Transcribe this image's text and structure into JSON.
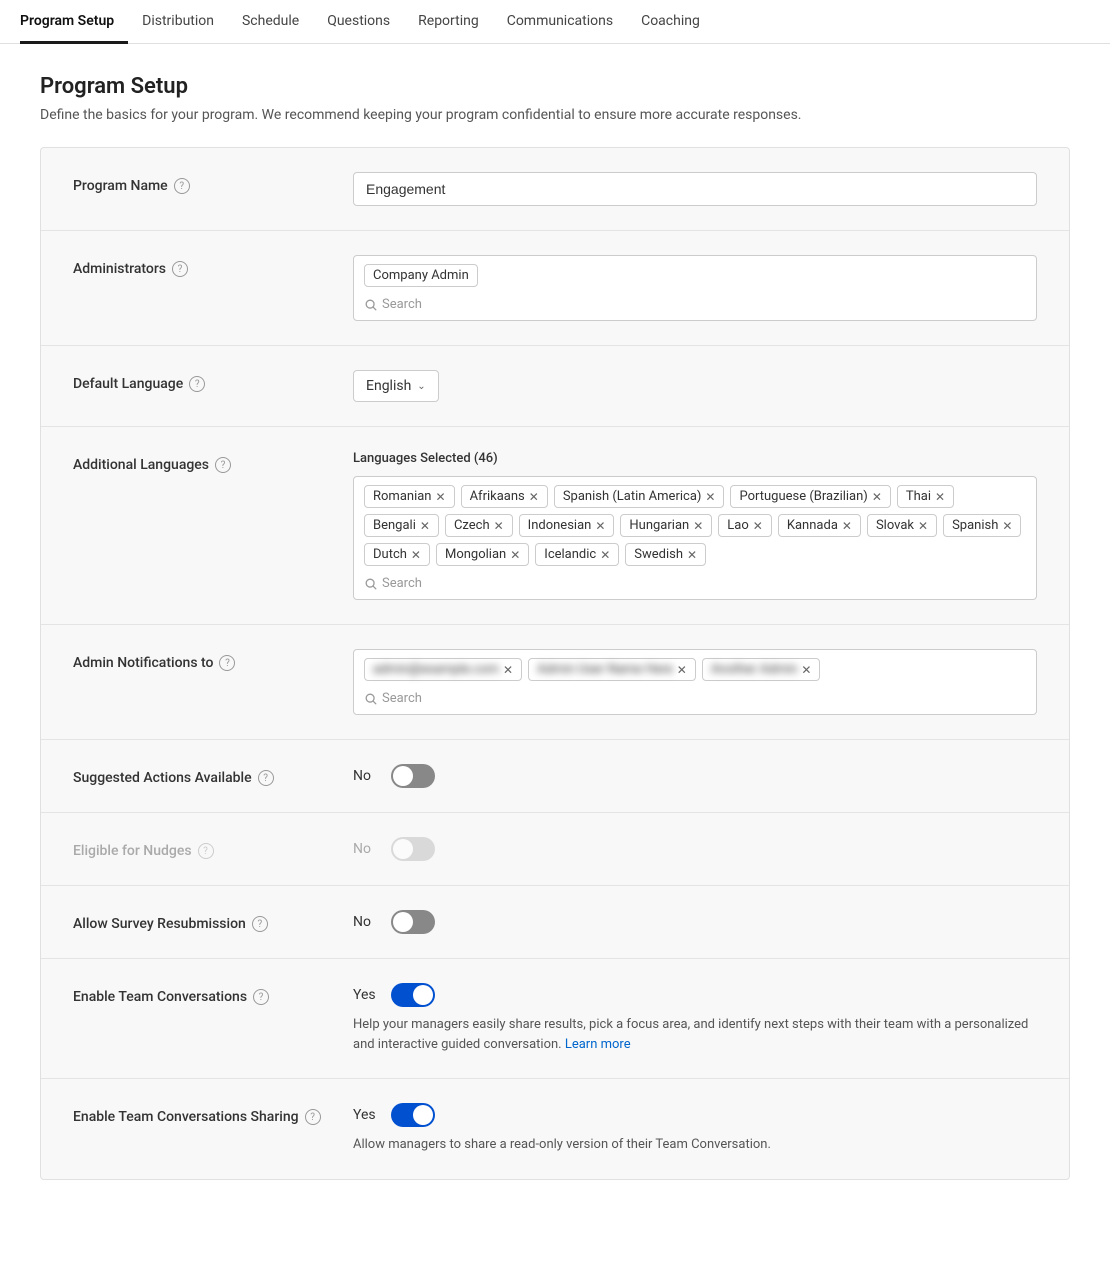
{
  "nav": {
    "items": [
      {
        "label": "Program Setup",
        "active": true
      },
      {
        "label": "Distribution",
        "active": false
      },
      {
        "label": "Schedule",
        "active": false
      },
      {
        "label": "Questions",
        "active": false
      },
      {
        "label": "Reporting",
        "active": false
      },
      {
        "label": "Communications",
        "active": false
      },
      {
        "label": "Coaching",
        "active": false
      }
    ]
  },
  "page": {
    "title": "Program Setup",
    "description": "Define the basics for your program. We recommend keeping your program confidential to ensure more accurate responses."
  },
  "form": {
    "program_name": {
      "label": "Program Name",
      "value": "Engagement"
    },
    "administrators": {
      "label": "Administrators",
      "tag": "Company Admin",
      "search_placeholder": "Search"
    },
    "default_language": {
      "label": "Default Language",
      "value": "English"
    },
    "additional_languages": {
      "label": "Additional Languages",
      "selected_count_label": "Languages Selected (46)",
      "search_placeholder": "Search",
      "tags": [
        "Romanian",
        "Afrikaans",
        "Spanish (Latin America)",
        "Portuguese (Brazilian)",
        "Thai",
        "Bengali",
        "Czech",
        "Indonesian",
        "Hungarian",
        "Lao",
        "Kannada",
        "Slovak",
        "Spanish",
        "Dutch",
        "Mongolian",
        "Icelandic",
        "Swedish"
      ]
    },
    "admin_notifications": {
      "label": "Admin Notifications to",
      "search_placeholder": "Search",
      "tags": [
        {
          "text": "••••••••@example.com)",
          "blurred": true
        },
        {
          "text": "A••••••••••••••••••)",
          "blurred": true
        },
        {
          "text": "A••••••••••••••",
          "blurred": true
        }
      ]
    },
    "suggested_actions": {
      "label": "Suggested Actions Available",
      "state": "off",
      "value_label": "No"
    },
    "eligible_nudges": {
      "label": "Eligible for Nudges",
      "state": "disabled",
      "value_label": "No"
    },
    "allow_resubmission": {
      "label": "Allow Survey Resubmission",
      "state": "off",
      "value_label": "No"
    },
    "enable_team_conversations": {
      "label": "Enable Team Conversations",
      "state": "on",
      "value_label": "Yes",
      "description": "Help your managers easily share results, pick a focus area, and identify next steps with their team with a personalized and interactive guided conversation.",
      "learn_more_label": "Learn more",
      "learn_more_url": "#"
    },
    "enable_sharing": {
      "label": "Enable Team Conversations Sharing",
      "state": "on",
      "value_label": "Yes",
      "description": "Allow managers to share a read-only version of their Team Conversation."
    }
  },
  "icons": {
    "help": "?",
    "chevron_down": "∨",
    "search": "search",
    "close": "×"
  }
}
